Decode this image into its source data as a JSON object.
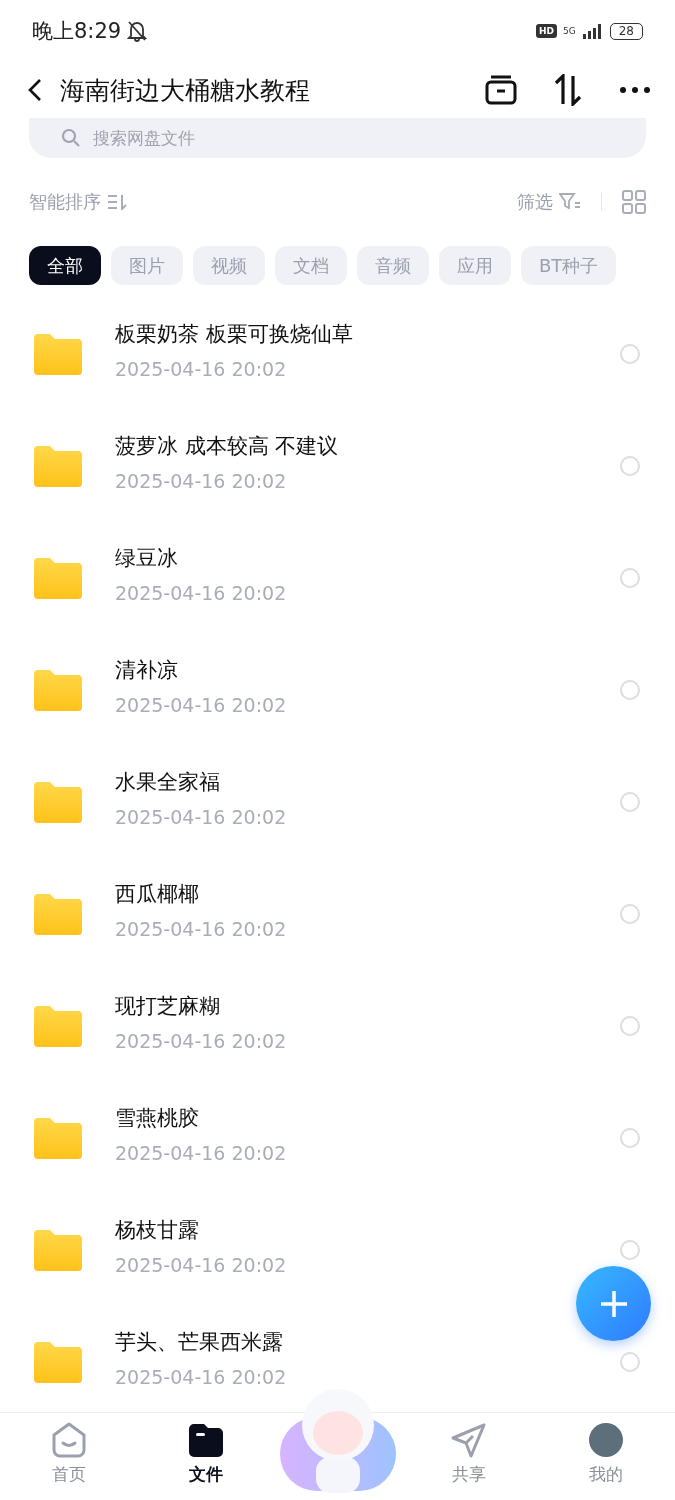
{
  "status_bar": {
    "time": "晚上8:29",
    "badge": "HD",
    "network": "5G",
    "battery": "28"
  },
  "header": {
    "title": "海南街边大桶糖水教程"
  },
  "search": {
    "placeholder": "搜索网盘文件"
  },
  "toolbar": {
    "sort_label": "智能排序",
    "filter_label": "筛选"
  },
  "chips": [
    {
      "label": "全部",
      "selected": true
    },
    {
      "label": "图片",
      "selected": false
    },
    {
      "label": "视频",
      "selected": false
    },
    {
      "label": "文档",
      "selected": false
    },
    {
      "label": "音频",
      "selected": false
    },
    {
      "label": "应用",
      "selected": false
    },
    {
      "label": "BT种子",
      "selected": false
    }
  ],
  "files": [
    {
      "name": "板栗奶茶 板栗可换烧仙草",
      "date": "2025-04-16  20:02",
      "checked": false
    },
    {
      "name": "菠萝冰 成本较高 不建议",
      "date": "2025-04-16  20:02",
      "checked": false
    },
    {
      "name": "绿豆冰",
      "date": "2025-04-16  20:02",
      "checked": false
    },
    {
      "name": "清补凉",
      "date": "2025-04-16  20:02",
      "checked": false
    },
    {
      "name": "水果全家福",
      "date": "2025-04-16  20:02",
      "checked": false
    },
    {
      "name": "西瓜椰椰",
      "date": "2025-04-16  20:02",
      "checked": false
    },
    {
      "name": "现打芝麻糊",
      "date": "2025-04-16  20:02",
      "checked": false
    },
    {
      "name": "雪燕桃胶",
      "date": "2025-04-16  20:02",
      "checked": false
    },
    {
      "name": "杨枝甘露",
      "date": "2025-04-16  20:02",
      "checked": false
    },
    {
      "name": "芋头、芒果西米露",
      "date": "2025-04-16  20:02",
      "checked": false
    }
  ],
  "nav": [
    {
      "label": "首页",
      "kind": "home",
      "selected": false
    },
    {
      "label": "文件",
      "kind": "files",
      "selected": true
    },
    {
      "kind": "mascot"
    },
    {
      "label": "共享",
      "kind": "share",
      "selected": false
    },
    {
      "label": "我的",
      "kind": "avatar",
      "selected": false
    }
  ]
}
